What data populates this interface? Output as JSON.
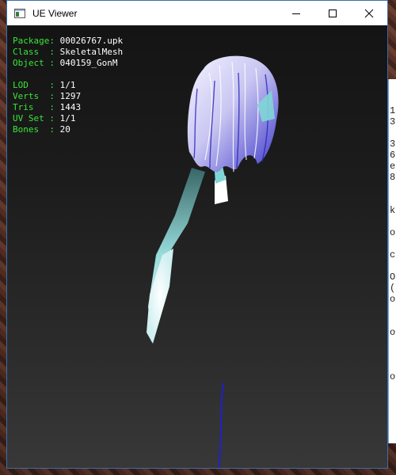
{
  "window": {
    "title": "UE Viewer"
  },
  "controls": {
    "minimize_icon": "minimize-icon",
    "maximize_icon": "maximize-icon",
    "close_icon": "close-icon"
  },
  "info": {
    "package": {
      "label": "Package",
      "sep": ": ",
      "value": "00026767.upk"
    },
    "class": {
      "label": "Class  ",
      "sep": ": ",
      "value": "SkeletalMesh"
    },
    "object": {
      "label": "Object ",
      "sep": ": ",
      "value": "040159_GonM"
    },
    "lod": {
      "label": "LOD    ",
      "sep": ": ",
      "value": "1/1"
    },
    "verts": {
      "label": "Verts  ",
      "sep": ": ",
      "value": "1297"
    },
    "tris": {
      "label": "Tris   ",
      "sep": ": ",
      "value": "1443"
    },
    "uvset": {
      "label": "UV Set ",
      "sep": ": ",
      "value": "1/1"
    },
    "bones": {
      "label": "Bones  ",
      "sep": ": ",
      "value": "20"
    }
  },
  "colors": {
    "label": "#39e639",
    "value": "#ffffff",
    "axis": "#1a1aff",
    "hair": "#c8c8f0"
  }
}
